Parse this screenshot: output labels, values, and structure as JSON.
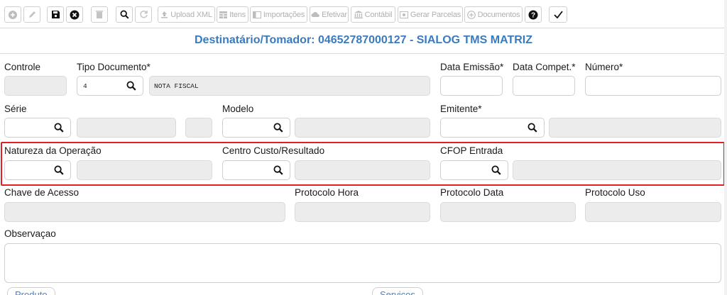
{
  "toolbar": {
    "upload_xml": "Upload XML",
    "itens": "Itens",
    "importacoes": "Importações",
    "efetivar": "Efetivar",
    "contabil": "Contábil",
    "gerar_parcelas": "Gerar Parcelas",
    "documentos": "Documentos"
  },
  "header": {
    "title": "Destinatário/Tomador: 04652787000127 - SIALOG TMS MATRIZ"
  },
  "form": {
    "controle": {
      "label": "Controle",
      "value": ""
    },
    "tipo_documento": {
      "label": "Tipo Documento*",
      "code": "4",
      "description": "NOTA FISCAL"
    },
    "data_emissao": {
      "label": "Data Emissão*",
      "value": ""
    },
    "data_compet": {
      "label": "Data Compet.*",
      "value": ""
    },
    "numero": {
      "label": "Número*",
      "value": ""
    },
    "serie": {
      "label": "Série",
      "value": ""
    },
    "modelo": {
      "label": "Modelo",
      "value": ""
    },
    "emitente": {
      "label": "Emitente*",
      "value": ""
    },
    "natureza_operacao": {
      "label": "Natureza da Operação",
      "value": ""
    },
    "centro_custo": {
      "label": "Centro Custo/Resultado",
      "value": ""
    },
    "cfop_entrada": {
      "label": "CFOP Entrada",
      "value": ""
    },
    "chave_acesso": {
      "label": "Chave de Acesso",
      "value": ""
    },
    "protocolo_hora": {
      "label": "Protocolo Hora",
      "value": ""
    },
    "protocolo_data": {
      "label": "Protocolo Data",
      "value": ""
    },
    "protocolo_uso": {
      "label": "Protocolo Uso",
      "value": ""
    },
    "observacao": {
      "label": "Observaçao",
      "value": ""
    }
  },
  "bottom_tabs": {
    "produto": "Produto",
    "servicos": "Serviços"
  },
  "colors": {
    "title": "#3a7bbf",
    "highlight": "#e01f26",
    "readonly_bg": "#ececec",
    "border": "#cfcfcf"
  }
}
